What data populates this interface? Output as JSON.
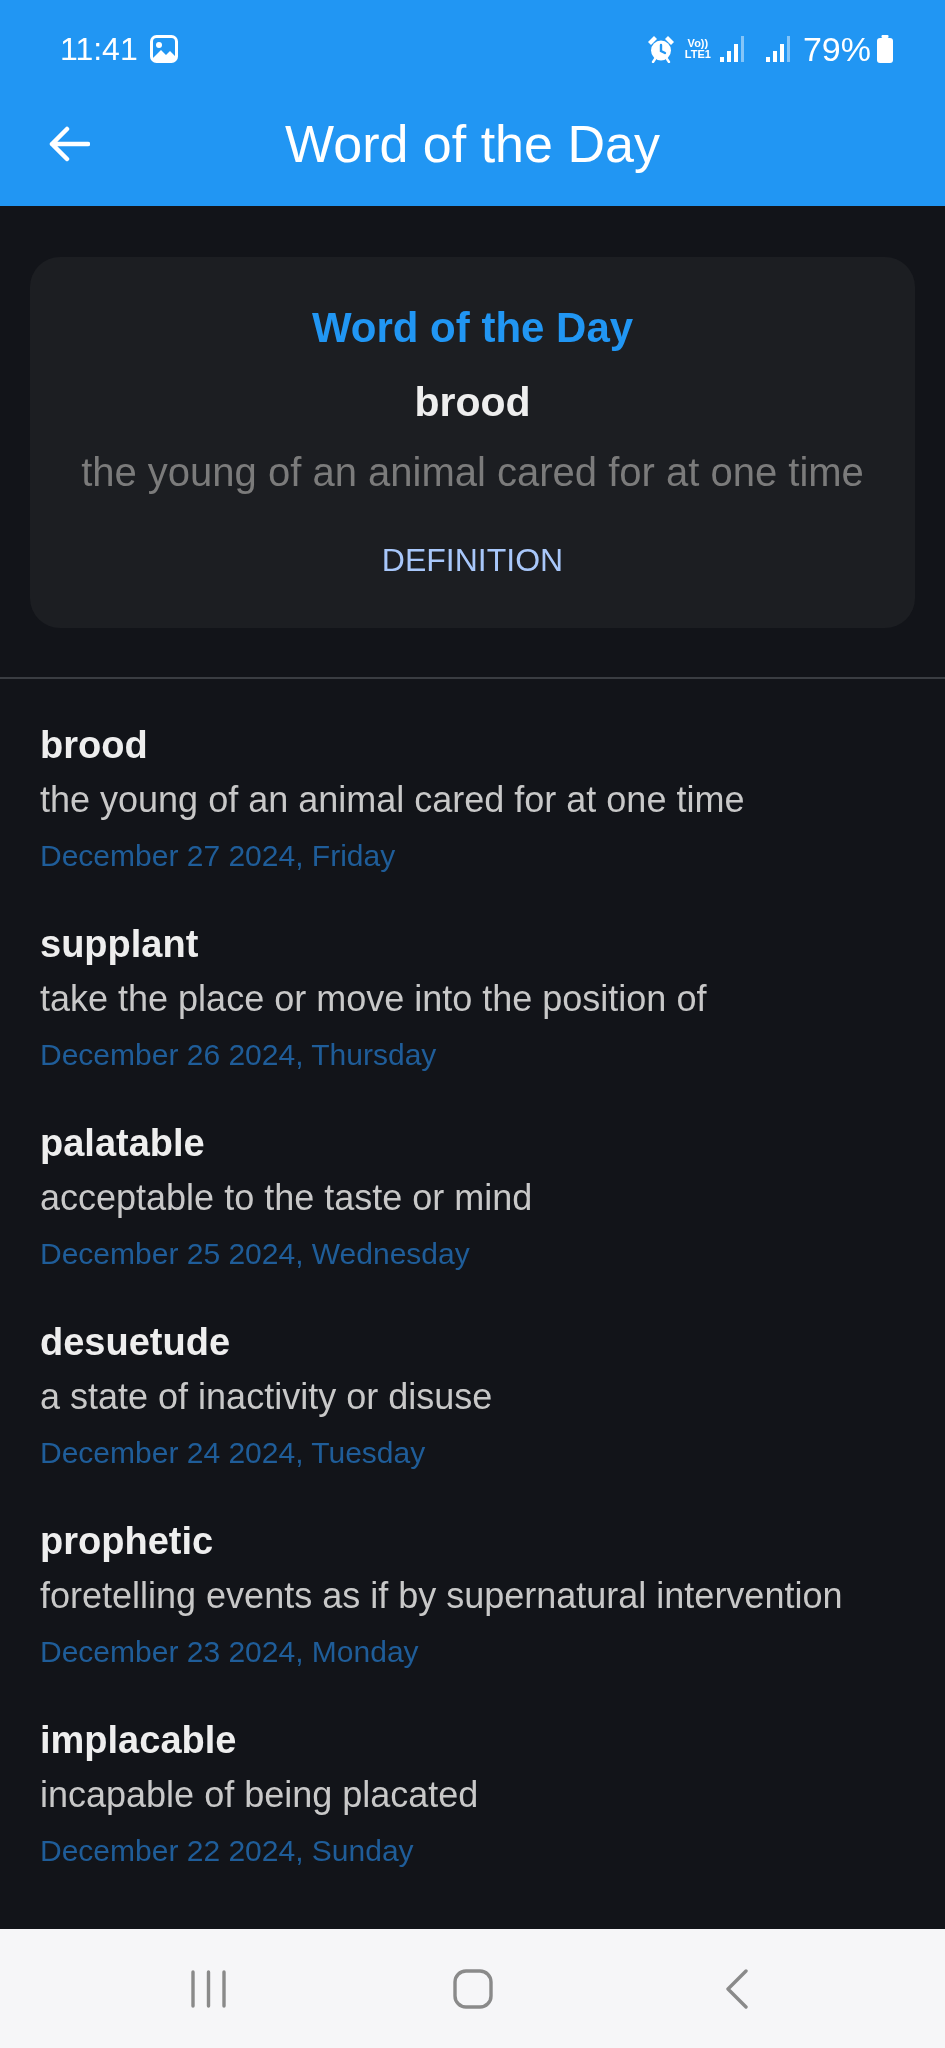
{
  "status_bar": {
    "time": "11:41",
    "network_label": [
      "Vo))",
      "LTE1"
    ],
    "battery": "79%"
  },
  "app_bar": {
    "title": "Word of the Day"
  },
  "featured": {
    "heading": "Word of the Day",
    "word": "brood",
    "definition": "the young of an animal cared for at one time",
    "button": "DEFINITION"
  },
  "history": [
    {
      "word": "brood",
      "definition": "the young of an animal cared for at one time",
      "date": "December 27 2024, Friday"
    },
    {
      "word": "supplant",
      "definition": "take the place or move into the position of",
      "date": "December 26 2024, Thursday"
    },
    {
      "word": "palatable",
      "definition": "acceptable to the taste or mind",
      "date": "December 25 2024, Wednesday"
    },
    {
      "word": "desuetude",
      "definition": "a state of inactivity or disuse",
      "date": "December 24 2024, Tuesday"
    },
    {
      "word": "prophetic",
      "definition": "foretelling events as if by supernatural intervention",
      "date": "December 23 2024, Monday"
    },
    {
      "word": "implacable",
      "definition": "incapable of being placated",
      "date": "December 22 2024, Sunday"
    }
  ]
}
